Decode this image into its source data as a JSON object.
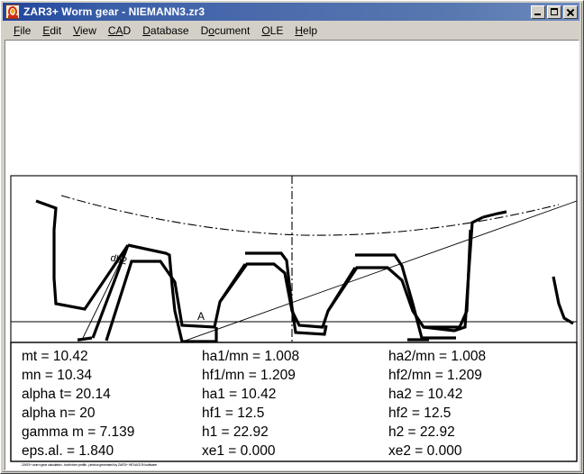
{
  "window": {
    "title": "ZAR3+  Worm gear  -  NIEMANN3.zr3",
    "icon": "zar3-app-icon",
    "controls": {
      "minimize_label": "Minimize",
      "maximize_label": "Maximize",
      "close_label": "Close"
    }
  },
  "menubar": {
    "items": [
      {
        "label": "File",
        "accel": "F"
      },
      {
        "label": "Edit",
        "accel": "E"
      },
      {
        "label": "View",
        "accel": "V"
      },
      {
        "label": "CAD",
        "accel": "C"
      },
      {
        "label": "Database",
        "accel": "D"
      },
      {
        "label": "Document",
        "accel": "o"
      },
      {
        "label": "OLE",
        "accel": "O"
      },
      {
        "label": "Help",
        "accel": "H"
      }
    ]
  },
  "drawing": {
    "title": "worm-gear-tooth-profile",
    "annotations": [
      {
        "name": "db2-label",
        "text": "db2"
      },
      {
        "name": "point-a-label",
        "text": "A"
      }
    ],
    "line_color": "#000000",
    "background": "#ffffff"
  },
  "results_table": {
    "columns": [
      {
        "name": "column-basic-geometry",
        "rows": [
          "mt = 10.42",
          "mn = 10.34",
          "alpha t= 20.14",
          "alpha n= 20",
          "gamma m = 7.139",
          "eps.al. = 1.840"
        ]
      },
      {
        "name": "column-worm-1",
        "rows": [
          "ha1/mn = 1.008",
          "hf1/mn = 1.209",
          "ha1 = 10.42",
          "hf1 = 12.5",
          "h1 = 22.92",
          "xe1 = 0.000"
        ]
      },
      {
        "name": "column-wheel-2",
        "rows": [
          "ha2/mn = 1.008",
          "hf2/mn = 1.209",
          "ha2 = 10.42",
          "hf2 = 12.5",
          "h2 = 22.92",
          "xe2 = 0.000"
        ]
      }
    ]
  },
  "footer": {
    "microtext": "ZAR3+ worm gear calculation - tooth form profile - printout generated by ZAR3+ HEXAGON software"
  }
}
